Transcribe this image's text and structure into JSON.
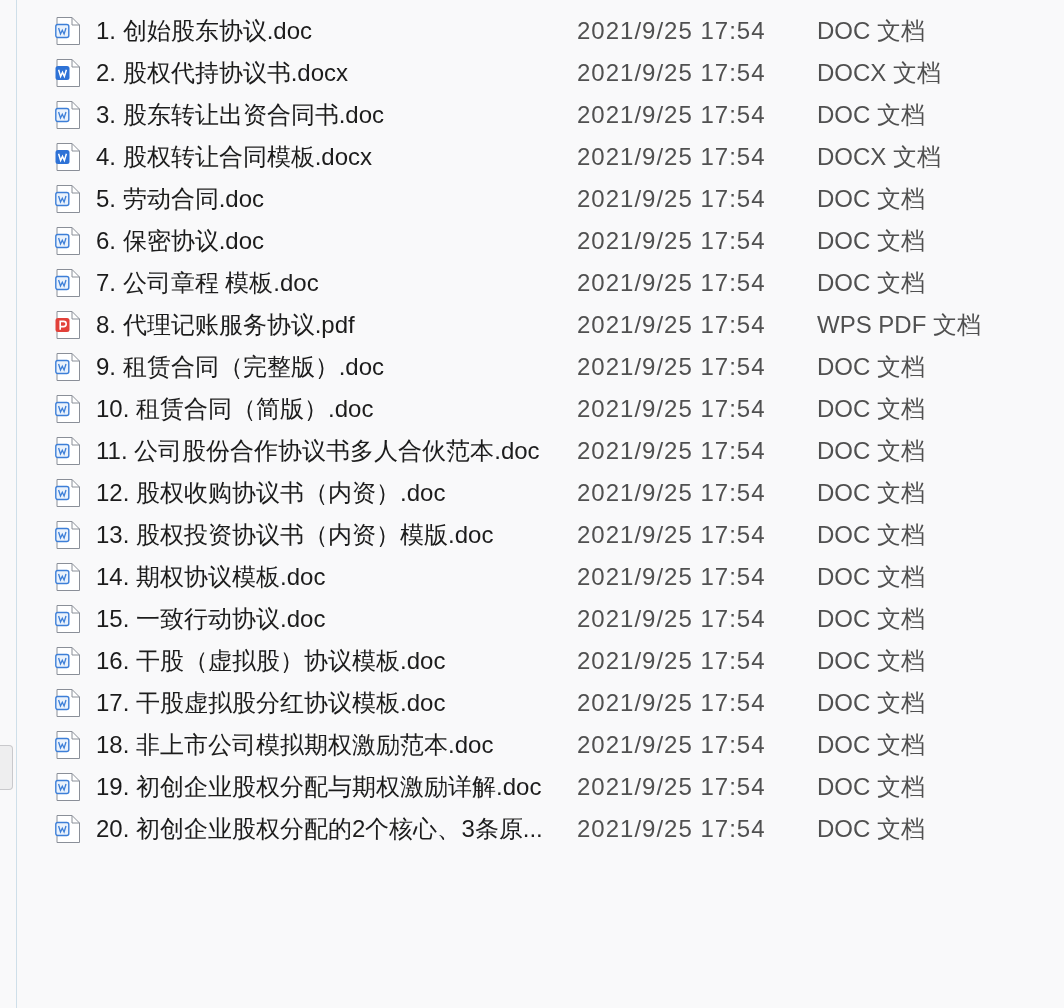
{
  "files": [
    {
      "name": "1. 创始股东协议.doc",
      "modified": "2021/9/25 17:54",
      "type": "DOC 文档",
      "kind": "doc"
    },
    {
      "name": "2. 股权代持协议书.docx",
      "modified": "2021/9/25 17:54",
      "type": "DOCX 文档",
      "kind": "docx"
    },
    {
      "name": "3. 股东转让出资合同书.doc",
      "modified": "2021/9/25 17:54",
      "type": "DOC 文档",
      "kind": "doc"
    },
    {
      "name": "4. 股权转让合同模板.docx",
      "modified": "2021/9/25 17:54",
      "type": "DOCX 文档",
      "kind": "docx"
    },
    {
      "name": "5. 劳动合同.doc",
      "modified": "2021/9/25 17:54",
      "type": "DOC 文档",
      "kind": "doc"
    },
    {
      "name": "6. 保密协议.doc",
      "modified": "2021/9/25 17:54",
      "type": "DOC 文档",
      "kind": "doc"
    },
    {
      "name": "7. 公司章程 模板.doc",
      "modified": "2021/9/25 17:54",
      "type": "DOC 文档",
      "kind": "doc"
    },
    {
      "name": "8. 代理记账服务协议.pdf",
      "modified": "2021/9/25 17:54",
      "type": "WPS PDF 文档",
      "kind": "pdf"
    },
    {
      "name": "9. 租赁合同（完整版）.doc",
      "modified": "2021/9/25 17:54",
      "type": "DOC 文档",
      "kind": "doc"
    },
    {
      "name": "10. 租赁合同（简版）.doc",
      "modified": "2021/9/25 17:54",
      "type": "DOC 文档",
      "kind": "doc"
    },
    {
      "name": "11. 公司股份合作协议书多人合伙范本.doc",
      "modified": "2021/9/25 17:54",
      "type": "DOC 文档",
      "kind": "doc"
    },
    {
      "name": "12. 股权收购协议书（内资）.doc",
      "modified": "2021/9/25 17:54",
      "type": "DOC 文档",
      "kind": "doc"
    },
    {
      "name": "13. 股权投资协议书（内资）模版.doc",
      "modified": "2021/9/25 17:54",
      "type": "DOC 文档",
      "kind": "doc"
    },
    {
      "name": "14. 期权协议模板.doc",
      "modified": "2021/9/25 17:54",
      "type": "DOC 文档",
      "kind": "doc"
    },
    {
      "name": "15. 一致行动协议.doc",
      "modified": "2021/9/25 17:54",
      "type": "DOC 文档",
      "kind": "doc"
    },
    {
      "name": "16. 干股（虚拟股）协议模板.doc",
      "modified": "2021/9/25 17:54",
      "type": "DOC 文档",
      "kind": "doc"
    },
    {
      "name": "17. 干股虚拟股分红协议模板.doc",
      "modified": "2021/9/25 17:54",
      "type": "DOC 文档",
      "kind": "doc"
    },
    {
      "name": "18. 非上市公司模拟期权激励范本.doc",
      "modified": "2021/9/25 17:54",
      "type": "DOC 文档",
      "kind": "doc"
    },
    {
      "name": "19. 初创企业股权分配与期权激励详解.doc",
      "modified": "2021/9/25 17:54",
      "type": "DOC 文档",
      "kind": "doc"
    },
    {
      "name": "20. 初创企业股权分配的2个核心、3条原...",
      "modified": "2021/9/25 17:54",
      "type": "DOC 文档",
      "kind": "doc"
    }
  ]
}
